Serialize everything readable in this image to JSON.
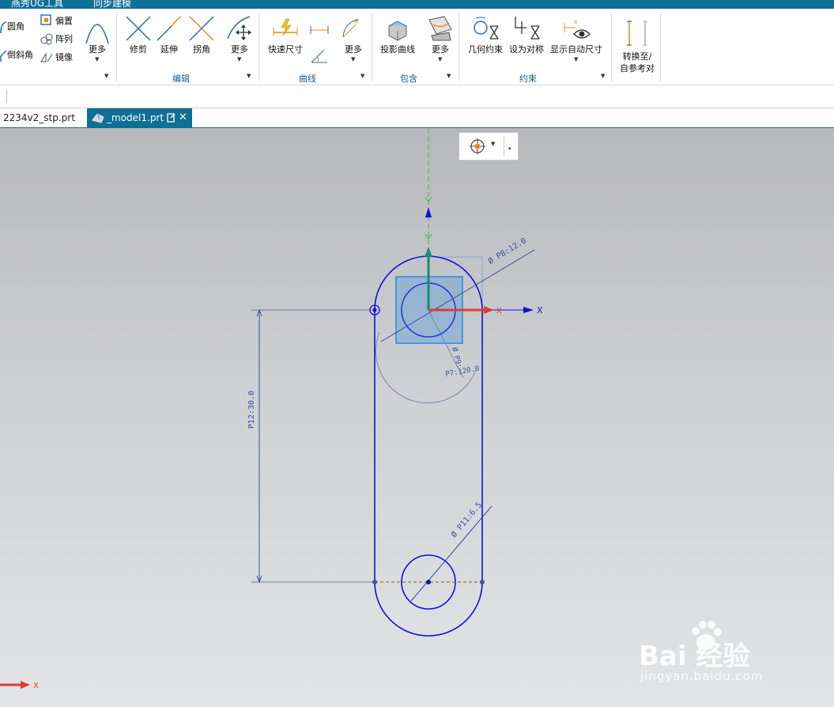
{
  "menubar": {
    "tabs": [
      "燕秀UG工具",
      "同步建模"
    ]
  },
  "ribbon": {
    "groups": [
      {
        "label": "编辑",
        "items": [
          "修剪",
          "延伸",
          "拐角",
          "更多"
        ]
      },
      {
        "label": "曲线",
        "items": [
          "快速尺寸",
          "更多"
        ]
      },
      {
        "label": "包含",
        "items": [
          "投影曲线",
          "更多"
        ]
      },
      {
        "label": "约束",
        "items": [
          "几何约束",
          "设为对称",
          "显示自动尺寸"
        ]
      }
    ],
    "left_items": [
      "圆角",
      "倒斜角",
      "偏置",
      "阵列",
      "镜像",
      "更多"
    ],
    "convert_line1": "转换至/",
    "convert_line2": "自参考对"
  },
  "tabs": [
    {
      "label": "2234v2_stp.prt",
      "active": false
    },
    {
      "label": "_model1.prt",
      "active": true
    }
  ],
  "sketch": {
    "axis_x": "X",
    "axis_y": "Y",
    "dims": {
      "p8": "Ø P8:12.0",
      "p9": "Ø P9:",
      "p7": "P7:120.0",
      "p12": "P12:30.0",
      "p11": "Ø P11:6.5"
    },
    "triad_x": "X"
  },
  "watermark": {
    "brand": "Bai  经验",
    "url": "jingyan.baidu.com"
  },
  "colors": {
    "accent": "#0f6f94",
    "sketch": "#1010d8",
    "dim": "#3a4fa6",
    "x_axis": "#e03c31",
    "y_axis": "#1a8a7a"
  }
}
